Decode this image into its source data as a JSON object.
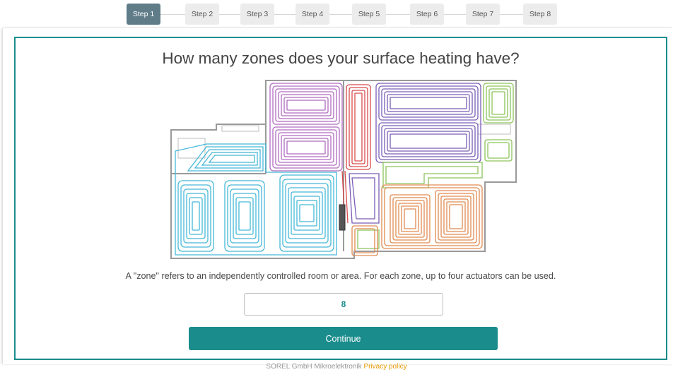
{
  "stepper": {
    "steps": [
      "Step 1",
      "Step 2",
      "Step 3",
      "Step 4",
      "Step 5",
      "Step 6",
      "Step 7",
      "Step 8"
    ],
    "active_index": 0
  },
  "main": {
    "title": "How many zones does your surface heating have?",
    "floorplan_image": "floor-plan-heating-zones",
    "description": "A \"zone\" refers to an independently controlled room or area. For each zone, up to four actuators can be used.",
    "zone_input": {
      "value": "8"
    },
    "continue_label": "Continue"
  },
  "footer": {
    "company": "SOREL GmbH Mikroelektronik",
    "privacy_link": "Privacy policy"
  },
  "colors": {
    "accent": "#1a8c8c",
    "active_step": "#607c89",
    "inactive_step": "#ececec",
    "link": "#e69a00",
    "zone_cyan": "#44b8d8",
    "zone_purple": "#b06ac0",
    "zone_red": "#d94a4a",
    "zone_violet": "#7a5cb5",
    "zone_green": "#8cc45a",
    "zone_orange": "#e08a50"
  }
}
